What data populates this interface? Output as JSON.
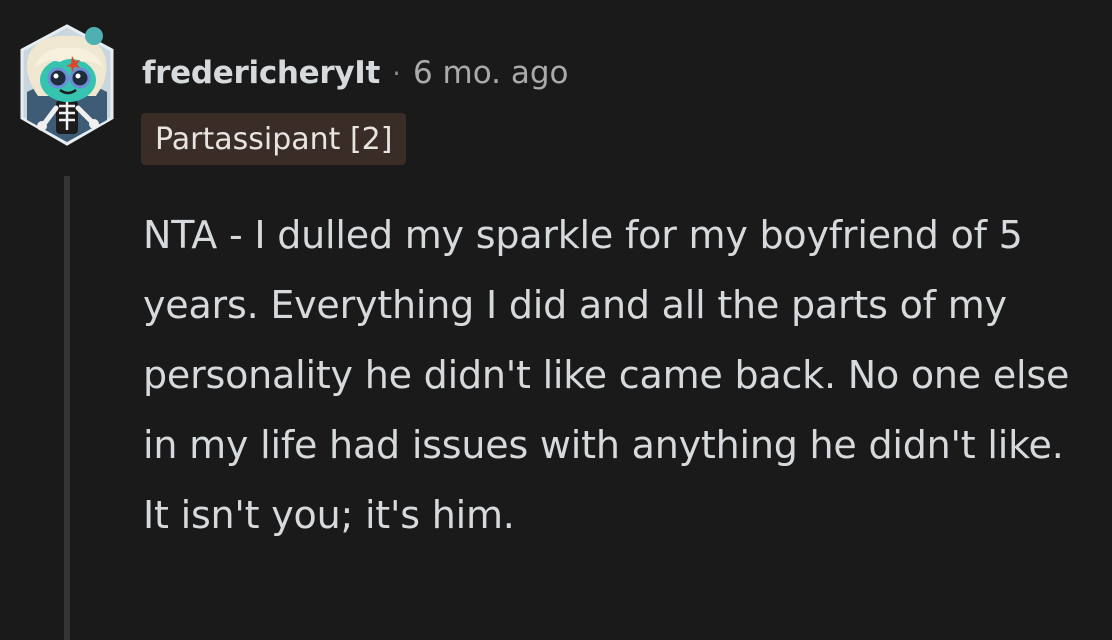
{
  "comment": {
    "author": "fredericheryIt",
    "separator": "·",
    "timestamp": "6 mo. ago",
    "flair": "Partassipant [2]",
    "body": "NTA - I dulled my sparkle for my boyfriend of 5 years. Everything I did and all the parts of my personality he didn't like came back. No one else in my life had issues with anything he didn't like. It isn't you; it's him."
  },
  "colors": {
    "background": "#1a1a1b",
    "text": "#d7dadc",
    "meta": "#a8aaab",
    "flair_bg": "#3a2c27",
    "thread_line": "#343536"
  },
  "icons": {
    "avatar": "snoo-avatar-icon"
  }
}
